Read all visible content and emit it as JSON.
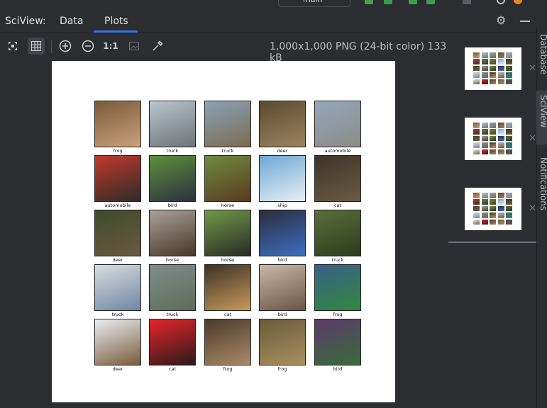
{
  "panel": {
    "title": "SciView:",
    "tabs": [
      {
        "label": "Data"
      },
      {
        "label": "Plots"
      }
    ],
    "active_tab": "Plots"
  },
  "top": {
    "run_config_label": "main"
  },
  "toolbar": {
    "zoom_actual_label": "1:1",
    "image_info": "1,000x1,000 PNG (24-bit color) 133 kB"
  },
  "grid_labels": [
    "frog",
    "truck",
    "truck",
    "deer",
    "automobile",
    "automobile",
    "bird",
    "horse",
    "ship",
    "cat",
    "deer",
    "horse",
    "horse",
    "bird",
    "truck",
    "truck",
    "truck",
    "cat",
    "bird",
    "frog",
    "deer",
    "cat",
    "frog",
    "frog",
    "bird"
  ],
  "thumb_colors": [
    [
      "#7a5a3a",
      "#c9a27a"
    ],
    [
      "#b9c4cc",
      "#6e757a"
    ],
    [
      "#8aa1b5",
      "#7b6b52"
    ],
    [
      "#5c4a2e",
      "#9b8460"
    ],
    [
      "#93a7bd",
      "#8d8b86"
    ],
    [
      "#c0392b",
      "#2e2b2a"
    ],
    [
      "#5f8f3a",
      "#2b3140"
    ],
    [
      "#6e8b3d",
      "#5a3a22"
    ],
    [
      "#6ea7d6",
      "#e8eef2"
    ],
    [
      "#3d3528",
      "#6b5a44"
    ],
    [
      "#3f4a2c",
      "#6a5a40"
    ],
    [
      "#a8a29a",
      "#4a3526"
    ],
    [
      "#6f9a4a",
      "#2b2a25"
    ],
    [
      "#2c2c3a",
      "#3b6fc4"
    ],
    [
      "#5a6e3a",
      "#2d3b1e"
    ],
    [
      "#d9dde1",
      "#6f86a3"
    ],
    [
      "#7f8c8d",
      "#5d6d5a"
    ],
    [
      "#3b3126",
      "#c99a5b"
    ],
    [
      "#c9b9a8",
      "#6a5542"
    ],
    [
      "#3a5f8a",
      "#2f8a3c"
    ],
    [
      "#e9eef2",
      "#7a5a3c"
    ],
    [
      "#e8242a",
      "#2a1a1c"
    ],
    [
      "#4c3a2a",
      "#a98a6a"
    ],
    [
      "#6b5a3a",
      "#a89060"
    ],
    [
      "#5c3a6a",
      "#3a6b3a"
    ]
  ],
  "previews": [
    {
      "id": 1
    },
    {
      "id": 2
    },
    {
      "id": 3
    }
  ],
  "side_tabs": [
    {
      "label": "Database"
    },
    {
      "label": "SciView"
    },
    {
      "label": "Notifications"
    }
  ]
}
